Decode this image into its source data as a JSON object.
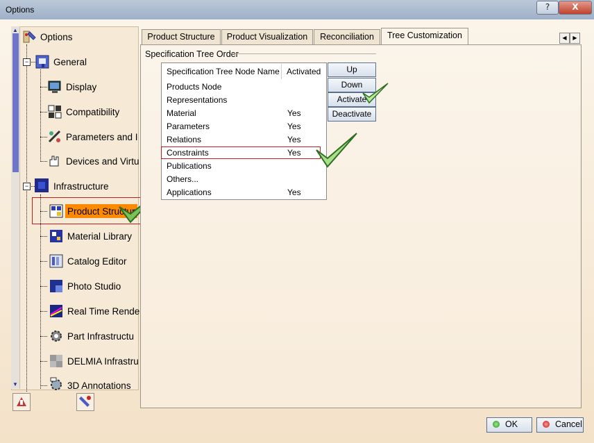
{
  "window": {
    "title": "Options",
    "help_label": "?",
    "close_label": "X"
  },
  "tree": {
    "root": "Options",
    "general": "General",
    "general_children": [
      "Display",
      "Compatibility",
      "Parameters and I",
      "Devices and Virtu"
    ],
    "infrastructure": "Infrastructure",
    "infra_children": [
      "Product Structur",
      "Material Library",
      "Catalog Editor",
      "Photo Studio",
      "Real Time Rende",
      "Part Infrastructu",
      "DELMIA Infrastru",
      "3D Annotations"
    ]
  },
  "tabs": [
    "Product Structure",
    "Product Visualization",
    "Reconciliation",
    "Tree Customization"
  ],
  "active_tab": "Tree Customization",
  "group": {
    "title": "Specification Tree Order"
  },
  "list": {
    "headers": [
      "Specification Tree Node Name",
      "Activated"
    ],
    "rows": [
      {
        "name": "Products Node",
        "activated": ""
      },
      {
        "name": "Representations",
        "activated": ""
      },
      {
        "name": "Material",
        "activated": "Yes"
      },
      {
        "name": "Parameters",
        "activated": "Yes"
      },
      {
        "name": "Relations",
        "activated": "Yes"
      },
      {
        "name": "Constraints",
        "activated": "Yes"
      },
      {
        "name": "Publications",
        "activated": ""
      },
      {
        "name": "Others...",
        "activated": ""
      },
      {
        "name": "Applications",
        "activated": "Yes"
      }
    ]
  },
  "buttons": {
    "up": "Up",
    "down": "Down",
    "activate": "Activate",
    "deactivate": "Deactivate",
    "ok": "OK",
    "cancel": "Cancel"
  },
  "colors": {
    "selection": "#ff8a00",
    "highlight_box": "#c21d1d",
    "check": "#5aa03a"
  }
}
